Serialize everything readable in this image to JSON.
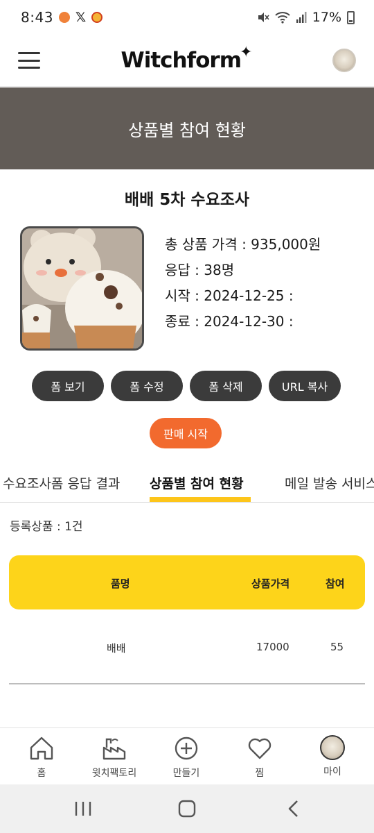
{
  "status_bar": {
    "time": "8:43",
    "x_label": "𝕏",
    "battery_percent": "17%"
  },
  "header": {
    "logo_text": "Witchform",
    "logo_star": "✦"
  },
  "banner": {
    "title": "상품별 참여 현황"
  },
  "survey": {
    "title": "배배 5차 수요조사",
    "total_price": "총 상품 가격 : 935,000원",
    "responses": "응답 : 38명",
    "start": "시작 : 2024-12-25 :",
    "end": "종료 : 2024-12-30 :"
  },
  "actions": {
    "view_form": "폼 보기",
    "edit_form": "폼 수정",
    "delete_form": "폼 삭제",
    "copy_url": "URL 복사",
    "start_sale": "판매 시작"
  },
  "tabs": [
    {
      "label": "수요조사폼 응답 결과"
    },
    {
      "label": "상품별 참여 현황",
      "active": true
    },
    {
      "label": "메일 발송 서비스"
    }
  ],
  "registered_count": "등록상품 : 1건",
  "table": {
    "headers": {
      "name": "품명",
      "price": "상품가격",
      "participation": "참여"
    },
    "rows": [
      {
        "name": "배배",
        "price": "17000",
        "participation": "55"
      }
    ]
  },
  "bottom_nav": {
    "home": "홈",
    "factory": "윗치팩토리",
    "create": "만들기",
    "wishlist": "찜",
    "my": "마이"
  },
  "colors": {
    "banner_bg": "#625c57",
    "accent_yellow": "#fdd41a",
    "sale_orange": "#f26a2e",
    "pill_dark": "#3b3b3b"
  }
}
